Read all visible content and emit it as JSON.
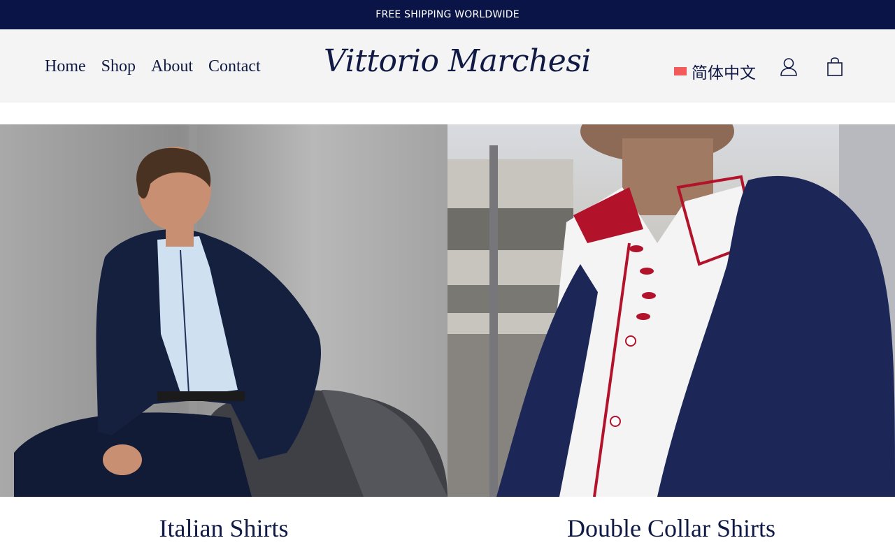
{
  "announcement": "FREE SHIPPING WORLDWIDE",
  "nav": {
    "home": "Home",
    "shop": "Shop",
    "about": "About",
    "contact": "Contact"
  },
  "brand": "Vittorio Marchesi",
  "language": {
    "label": "简体中文",
    "flag_color": "#f35a5a"
  },
  "icons": {
    "account": "user-icon",
    "cart": "shopping-bag-icon"
  },
  "colors": {
    "navy": "#0a1447",
    "header_bg": "#f4f4f4",
    "text": "#101a45"
  },
  "collections": [
    {
      "title": "Italian Shirts"
    },
    {
      "title": "Double Collar Shirts"
    }
  ]
}
